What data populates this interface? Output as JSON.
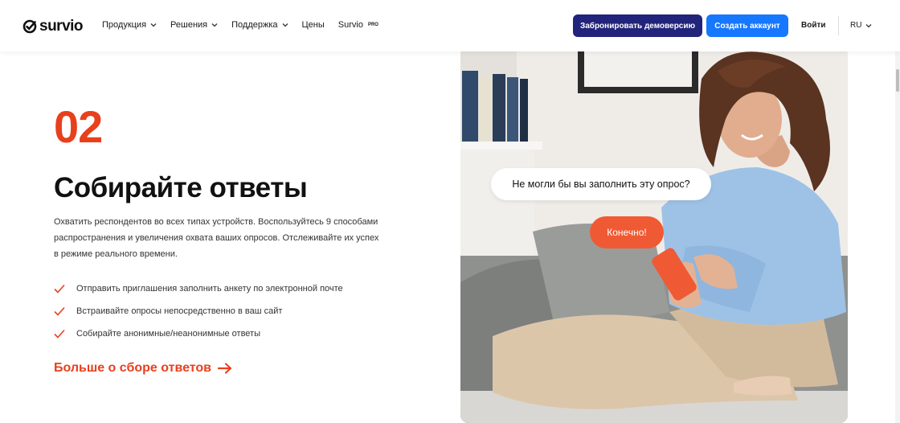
{
  "header": {
    "logo_text": "survio",
    "nav": [
      {
        "label": "Продукция",
        "has_dropdown": true
      },
      {
        "label": "Решения",
        "has_dropdown": true
      },
      {
        "label": "Поддержка",
        "has_dropdown": true
      },
      {
        "label": "Цены",
        "has_dropdown": false
      }
    ],
    "survio_pro": {
      "label": "Survio",
      "badge": "PRO"
    },
    "demo_button": "Забронировать демоверсию",
    "create_button": "Создать аккаунт",
    "login": "Войти",
    "language": "RU",
    "colors": {
      "demo_bg": "#22237a",
      "create_bg": "#1677ff"
    }
  },
  "section": {
    "number": "02",
    "title": "Собирайте ответы",
    "description": "Охватить респондентов во всех типах устройств. Воспользуйтесь 9 способами распространения и увеличения охвата ваших опросов. Отслеживайте их успех в режиме реального времени.",
    "features": [
      "Отправить приглашения заполнить анкету по электронной почте",
      "Встраивайте опросы непосредственно в ваш сайт",
      "Собирайте анонимные/неанонимные ответы"
    ],
    "more_link": "Больше о сборе ответов",
    "accent_color": "#e8401c"
  },
  "photo": {
    "bubble_question": "Не могли бы вы заполнить эту опрос?",
    "bubble_answer": "Конечно!"
  }
}
